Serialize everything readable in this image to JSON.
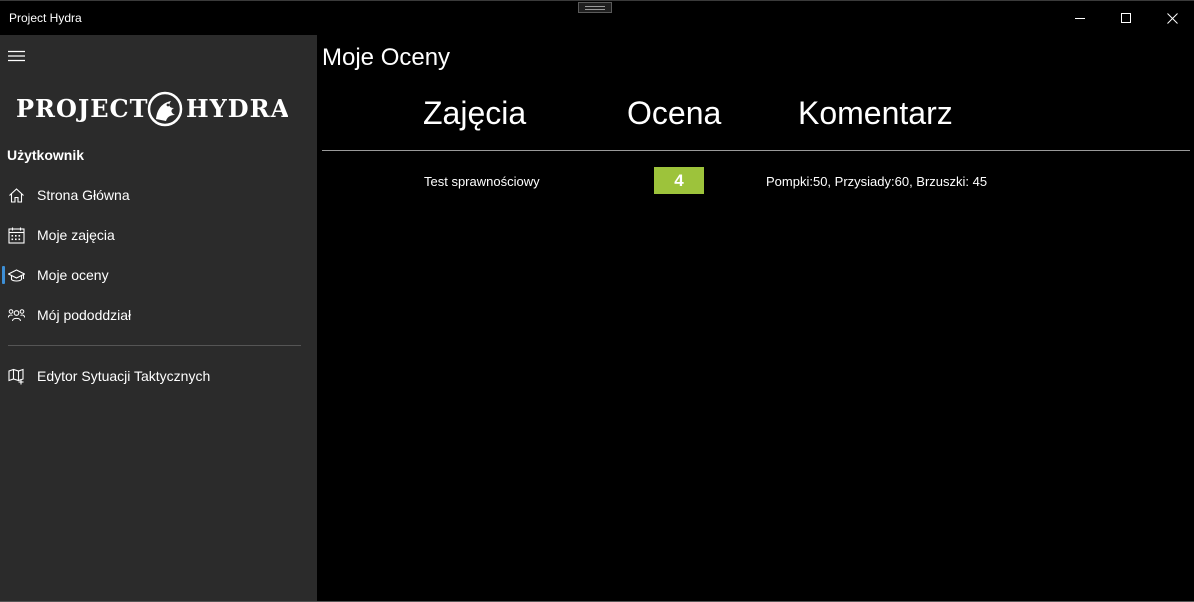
{
  "window": {
    "title": "Project Hydra"
  },
  "sidebar": {
    "logo_text": "PROJECT HYDRA",
    "section_header": "Użytkownik",
    "items": [
      {
        "label": "Strona Główna",
        "icon": "home-icon"
      },
      {
        "label": "Moje zajęcia",
        "icon": "calendar-icon"
      },
      {
        "label": "Moje oceny",
        "icon": "graduation-cap-icon",
        "selected": true
      },
      {
        "label": "Mój pododdział",
        "icon": "people-icon"
      },
      {
        "label": "Edytor Sytuacji Taktycznych",
        "icon": "map-icon"
      }
    ]
  },
  "main": {
    "page_title": "Moje Oceny",
    "columns": [
      "Zajęcia",
      "Ocena",
      "Komentarz"
    ],
    "rows": [
      {
        "subject": "Test sprawnościowy",
        "grade": "4",
        "comment": "Pompki:50, Przysiady:60, Brzuszki: 45"
      }
    ]
  },
  "colors": {
    "sidebar_bg": "#2b2b2b",
    "main_bg": "#000000",
    "accent": "#3d8fd6",
    "grade_badge": "#9dc33b"
  }
}
